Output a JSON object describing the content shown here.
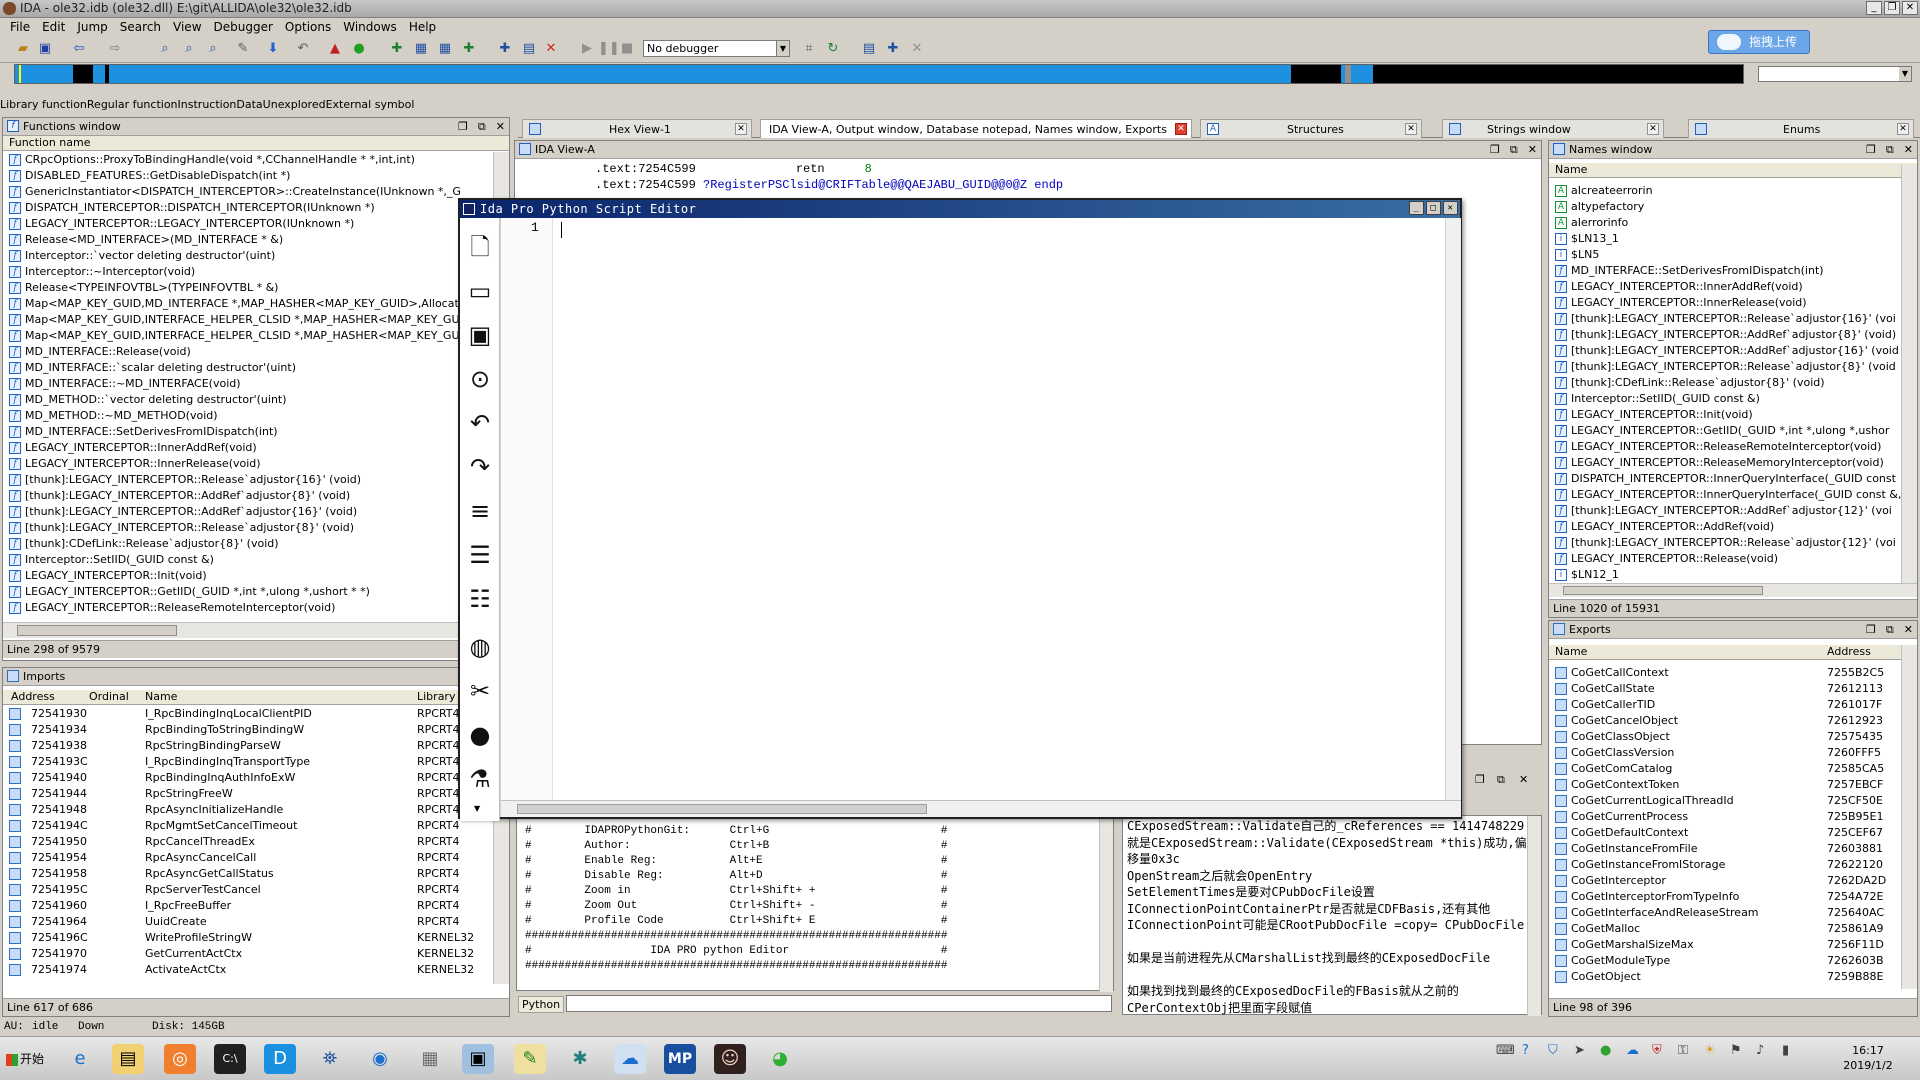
{
  "window": {
    "title": "IDA - ole32.idb (ole32.dll) E:\\git\\ALLIDA\\ole32\\ole32.idb",
    "minimize": "_",
    "restore": "❐",
    "close": "✕"
  },
  "menu": [
    "File",
    "Edit",
    "Jump",
    "Search",
    "View",
    "Debugger",
    "Options",
    "Windows",
    "Help"
  ],
  "toolbar": {
    "debugger_select": "No debugger"
  },
  "upload_button": "拖拽上传",
  "legend": [
    {
      "label": "Library function",
      "color": "#80e8ff"
    },
    {
      "label": "Regular function",
      "color": "#1e90e0"
    },
    {
      "label": "Instruction",
      "color": "#c08060"
    },
    {
      "label": "Data",
      "color": "#c8c8c8"
    },
    {
      "label": "Unexplored",
      "color": "#b8b888"
    },
    {
      "label": "External symbol",
      "color": "#ff80ff"
    }
  ],
  "functions_window": {
    "title": "Functions window",
    "column": "Function name",
    "rows": [
      "CRpcOptions::ProxyToBindingHandle(void *,CChannelHandle * *,int,int)",
      "DISABLED_FEATURES::GetDisableDispatch(int *)",
      "GenericInstantiator<DISPATCH_INTERCEPTOR>::CreateInstance(IUnknown *,_G",
      "DISPATCH_INTERCEPTOR::DISPATCH_INTERCEPTOR(IUnknown *)",
      "LEGACY_INTERCEPTOR::LEGACY_INTERCEPTOR(IUnknown *)",
      "Release<MD_INTERFACE>(MD_INTERFACE * &)",
      "Interceptor::`vector deleting destructor'(uint)",
      "Interceptor::~Interceptor(void)",
      "Release<TYPEINFOVTBL>(TYPEINFOVTBL * &)",
      "Map<MAP_KEY_GUID,MD_INTERFACE *,MAP_HASHER<MAP_KEY_GUID>,AllocateThrow>",
      "Map<MAP_KEY_GUID,INTERFACE_HELPER_CLSID *,MAP_HASHER<MAP_KEY_GUID>,Allo",
      "Map<MAP_KEY_GUID,INTERFACE_HELPER_CLSID *,MAP_HASHER<MAP_KEY_GUID>,Allo",
      "MD_INTERFACE::Release(void)",
      "MD_INTERFACE::`scalar deleting destructor'(uint)",
      "MD_INTERFACE::~MD_INTERFACE(void)",
      "MD_METHOD::`vector deleting destructor'(uint)",
      "MD_METHOD::~MD_METHOD(void)",
      "MD_INTERFACE::SetDerivesFromIDispatch(int)",
      "LEGACY_INTERCEPTOR::InnerAddRef(void)",
      "LEGACY_INTERCEPTOR::InnerRelease(void)",
      "[thunk]:LEGACY_INTERCEPTOR::Release`adjustor{16}' (void)",
      "[thunk]:LEGACY_INTERCEPTOR::AddRef`adjustor{8}' (void)",
      "[thunk]:LEGACY_INTERCEPTOR::AddRef`adjustor{16}' (void)",
      "[thunk]:LEGACY_INTERCEPTOR::Release`adjustor{8}' (void)",
      "[thunk]:CDefLink::Release`adjustor{8}' (void)",
      "Interceptor::SetIID(_GUID const &)",
      "LEGACY_INTERCEPTOR::Init(void)",
      "LEGACY_INTERCEPTOR::GetIID(_GUID *,int *,ulong *,ushort * *)",
      "LEGACY_INTERCEPTOR::ReleaseRemoteInterceptor(void)"
    ],
    "status": "Line 298 of 9579"
  },
  "imports_window": {
    "title": "Imports",
    "columns": [
      "Address",
      "Ordinal",
      "Name",
      "Library"
    ],
    "rows": [
      [
        "72541930",
        "",
        "I_RpcBindingInqLocalClientPID",
        "RPCRT4"
      ],
      [
        "72541934",
        "",
        "RpcBindingToStringBindingW",
        "RPCRT4"
      ],
      [
        "72541938",
        "",
        "RpcStringBindingParseW",
        "RPCRT4"
      ],
      [
        "7254193C",
        "",
        "I_RpcBindingInqTransportType",
        "RPCRT4"
      ],
      [
        "72541940",
        "",
        "RpcBindingInqAuthInfoExW",
        "RPCRT4"
      ],
      [
        "72541944",
        "",
        "RpcStringFreeW",
        "RPCRT4"
      ],
      [
        "72541948",
        "",
        "RpcAsyncInitializeHandle",
        "RPCRT4"
      ],
      [
        "7254194C",
        "",
        "RpcMgmtSetCancelTimeout",
        "RPCRT4"
      ],
      [
        "72541950",
        "",
        "RpcCancelThreadEx",
        "RPCRT4"
      ],
      [
        "72541954",
        "",
        "RpcAsyncCancelCall",
        "RPCRT4"
      ],
      [
        "72541958",
        "",
        "RpcAsyncGetCallStatus",
        "RPCRT4"
      ],
      [
        "7254195C",
        "",
        "RpcServerTestCancel",
        "RPCRT4"
      ],
      [
        "72541960",
        "",
        "I_RpcFreeBuffer",
        "RPCRT4"
      ],
      [
        "72541964",
        "",
        "UuidCreate",
        "RPCRT4"
      ],
      [
        "7254196C",
        "",
        "WriteProfileStringW",
        "KERNEL32"
      ],
      [
        "72541970",
        "",
        "GetCurrentActCtx",
        "KERNEL32"
      ],
      [
        "72541974",
        "",
        "ActivateActCtx",
        "KERNEL32"
      ]
    ],
    "status": "Line 617 of 686"
  },
  "bottom_status": {
    "au": "AU:",
    "state": "idle",
    "dir": "Down",
    "disk": "Disk: 145GB"
  },
  "tabs": [
    {
      "label": "Hex View-1"
    },
    {
      "label": "IDA View-A, Output window, Database notepad, Names window, Exports"
    },
    {
      "label": "Structures"
    },
    {
      "label": "Strings window"
    },
    {
      "label": "Enums"
    }
  ],
  "ida_view": {
    "title": "IDA View-A",
    "lines": [
      {
        "addr": ".text:7254C599",
        "op": "retn",
        "arg": "8",
        "extra": ""
      },
      {
        "addr": ".text:7254C599",
        "op": "?RegisterPSClsid@CRIFTable@@QAEJABU_GUID@@0@Z endp",
        "arg": "",
        "extra": ""
      }
    ]
  },
  "editor": {
    "title": "Ida Pro Python Script Editor",
    "line_number": "1",
    "sidebar_icons": [
      "new-file",
      "open-folder",
      "save",
      "run",
      "undo",
      "redo",
      "align",
      "list",
      "numbered-list",
      "globe",
      "tools",
      "github",
      "flask"
    ]
  },
  "output_lines": [
    "#        IDAPROPythonGit:      Ctrl+G                          #",
    "#        Author:               Ctrl+B                          #",
    "#        Enable Reg:           Alt+E                           #",
    "#        Disable Reg:          Alt+D                           #",
    "#        Zoom in               Ctrl+Shift+ +                   #",
    "#        Zoom Out              Ctrl+Shift+ -                   #",
    "#        Profile Code          Ctrl+Shift+ E                   #",
    "################################################################",
    "#                  IDA PRO python Editor                       #",
    "################################################################"
  ],
  "python_label": "Python",
  "notepad_lines": [
    "CExposedStream::Validate自己的_cReferences == 1414748229",
    "就是CExposedStream::Validate(CExposedStream *this)成功,偏",
    "移量0x3c",
    "OpenStream之后就会OpenEntry",
    "SetElementTimes是要对CPubDocFile设置",
    "IConnectionPointContainerPtr是否就是CDFBasis,还有其他",
    "IConnectionPoint可能是CRootPubDocFile =copy= CPubDocFile",
    "",
    "如果是当前进程先从CMarshalList找到最终的CExposedDocFile",
    "",
    "如果找到找到最终的CExposedDocFile的FBasis就从之前的",
    "CPerContextObj把里面字段赋值"
  ],
  "names_window": {
    "title": "Names window",
    "column": "Name",
    "rows": [
      {
        "k": "A",
        "t": "aIcreateerrorin"
      },
      {
        "k": "A",
        "t": "aItypefactory"
      },
      {
        "k": "A",
        "t": "aIerrorinfo"
      },
      {
        "k": "i",
        "t": "$LN13_1"
      },
      {
        "k": "i",
        "t": "$LN5"
      },
      {
        "k": "f",
        "t": "MD_INTERFACE::SetDerivesFromIDispatch(int)"
      },
      {
        "k": "f",
        "t": "LEGACY_INTERCEPTOR::InnerAddRef(void)"
      },
      {
        "k": "f",
        "t": "LEGACY_INTERCEPTOR::InnerRelease(void)"
      },
      {
        "k": "f",
        "t": "[thunk]:LEGACY_INTERCEPTOR::Release`adjustor{16}' (voi"
      },
      {
        "k": "f",
        "t": "[thunk]:LEGACY_INTERCEPTOR::AddRef`adjustor{8}' (void)"
      },
      {
        "k": "f",
        "t": "[thunk]:LEGACY_INTERCEPTOR::AddRef`adjustor{16}' (void"
      },
      {
        "k": "f",
        "t": "[thunk]:LEGACY_INTERCEPTOR::Release`adjustor{8}' (void"
      },
      {
        "k": "f",
        "t": "[thunk]:CDefLink::Release`adjustor{8}' (void)"
      },
      {
        "k": "f",
        "t": "Interceptor::SetIID(_GUID const &)"
      },
      {
        "k": "f",
        "t": "LEGACY_INTERCEPTOR::Init(void)"
      },
      {
        "k": "f",
        "t": "LEGACY_INTERCEPTOR::GetIID(_GUID *,int *,ulong *,ushor"
      },
      {
        "k": "f",
        "t": "LEGACY_INTERCEPTOR::ReleaseRemoteInterceptor(void)"
      },
      {
        "k": "f",
        "t": "LEGACY_INTERCEPTOR::ReleaseMemoryInterceptor(void)"
      },
      {
        "k": "f",
        "t": "DISPATCH_INTERCEPTOR::InnerQueryInterface(_GUID const"
      },
      {
        "k": "f",
        "t": "LEGACY_INTERCEPTOR::InnerQueryInterface(_GUID const &,"
      },
      {
        "k": "f",
        "t": "[thunk]:LEGACY_INTERCEPTOR::AddRef`adjustor{12}' (voi"
      },
      {
        "k": "f",
        "t": "LEGACY_INTERCEPTOR::AddRef(void)"
      },
      {
        "k": "f",
        "t": "[thunk]:LEGACY_INTERCEPTOR::Release`adjustor{12}' (voi"
      },
      {
        "k": "f",
        "t": "LEGACY_INTERCEPTOR::Release(void)"
      },
      {
        "k": "i",
        "t": "$LN12_1"
      }
    ],
    "status": "Line 1020 of 15931"
  },
  "exports_window": {
    "title": "Exports",
    "columns": [
      "Name",
      "Address"
    ],
    "rows": [
      [
        "CoGetCallContext",
        "7255B2C5"
      ],
      [
        "CoGetCallState",
        "72612113"
      ],
      [
        "CoGetCallerTID",
        "7261017F"
      ],
      [
        "CoGetCancelObject",
        "72612923"
      ],
      [
        "CoGetClassObject",
        "72575435"
      ],
      [
        "CoGetClassVersion",
        "7260FFF5"
      ],
      [
        "CoGetComCatalog",
        "72585CA5"
      ],
      [
        "CoGetContextToken",
        "7257EBCF"
      ],
      [
        "CoGetCurrentLogicalThreadId",
        "725CF50E"
      ],
      [
        "CoGetCurrentProcess",
        "725B95E1"
      ],
      [
        "CoGetDefaultContext",
        "725CEF67"
      ],
      [
        "CoGetInstanceFromFile",
        "72603881"
      ],
      [
        "CoGetInstanceFromIStorage",
        "72622120"
      ],
      [
        "CoGetInterceptor",
        "7262DA2D"
      ],
      [
        "CoGetInterceptorFromTypeInfo",
        "7254A72E"
      ],
      [
        "CoGetInterfaceAndReleaseStream",
        "725640AC"
      ],
      [
        "CoGetMalloc",
        "725861A9"
      ],
      [
        "CoGetMarshalSizeMax",
        "7256F11D"
      ],
      [
        "CoGetModuleType",
        "7262603B"
      ],
      [
        "CoGetObject",
        "7259B88E"
      ]
    ],
    "status": "Line 98 of 396"
  },
  "taskbar": {
    "start": "开始",
    "time": "16:17",
    "date": "2019/1/2"
  }
}
